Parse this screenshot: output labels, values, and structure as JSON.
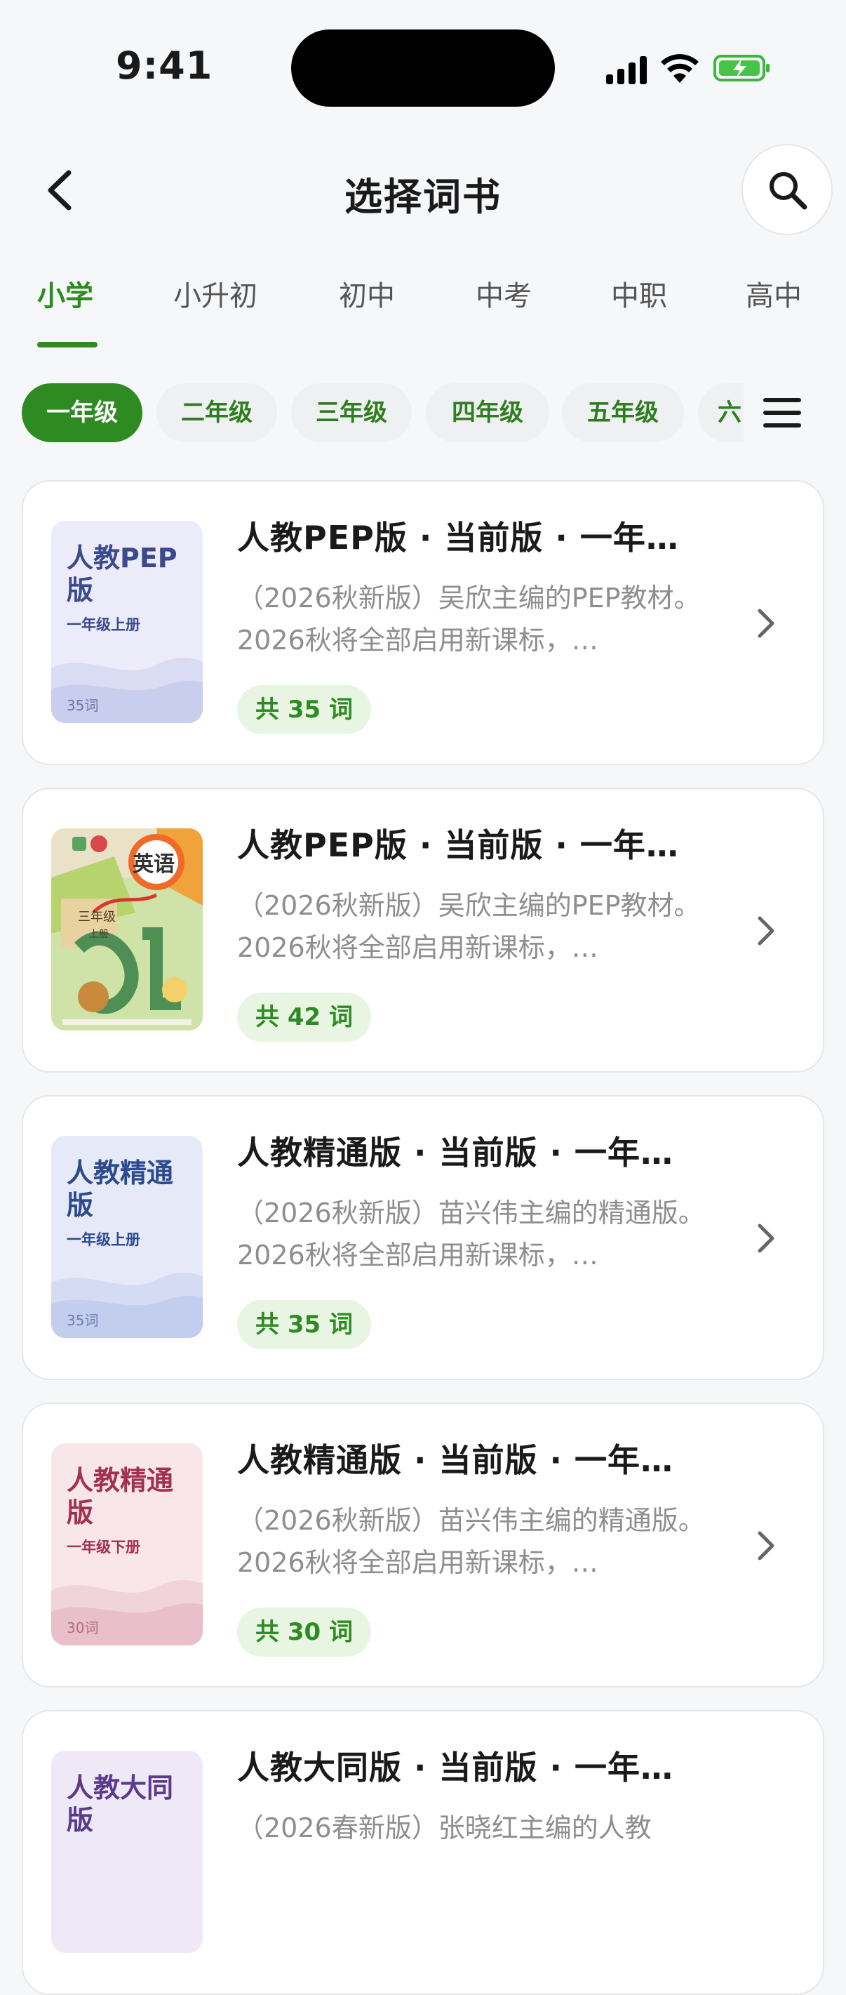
{
  "status_bar": {
    "time": "9:41"
  },
  "header": {
    "title": "选择词书"
  },
  "tabs": [
    {
      "label": "小学",
      "active": true
    },
    {
      "label": "小升初"
    },
    {
      "label": "初中"
    },
    {
      "label": "中考"
    },
    {
      "label": "中职"
    },
    {
      "label": "高中"
    }
  ],
  "grades": [
    {
      "label": "一年级",
      "active": true
    },
    {
      "label": "二年级"
    },
    {
      "label": "三年级"
    },
    {
      "label": "四年级"
    },
    {
      "label": "五年级"
    },
    {
      "label": "六"
    }
  ],
  "books": [
    {
      "title": "人教PEP版 · 当前版 · 一年…",
      "desc": "（2026秋新版）吴欣主编的PEP教材。2026秋将全部启用新课标，…",
      "count": "共 35 词",
      "cover": {
        "kind": "generated",
        "title": "人教PEP版",
        "sub": "一年级上册",
        "words": "35词",
        "bg": "#ECEBFA",
        "wave1": "#DADCF4",
        "wave2": "#C9CEEE",
        "fg": "#3A4A8A"
      }
    },
    {
      "title": "人教PEP版 · 当前版 · 一年…",
      "desc": "（2026秋新版）吴欣主编的PEP教材。2026秋将全部启用新课标，…",
      "count": "共 42 词",
      "cover": {
        "kind": "image",
        "badge": "英语",
        "grade_text": "三年级",
        "term_text": "上册"
      }
    },
    {
      "title": "人教精通版 · 当前版 · 一年…",
      "desc": "（2026秋新版）苗兴伟主编的精通版。2026秋将全部启用新课标，…",
      "count": "共 35 词",
      "cover": {
        "kind": "generated",
        "title": "人教精通版",
        "sub": "一年级上册",
        "words": "35词",
        "bg": "#E6EAF8",
        "wave1": "#D4DBF3",
        "wave2": "#C3CDEE",
        "fg": "#2C4A8E"
      }
    },
    {
      "title": "人教精通版 · 当前版 · 一年…",
      "desc": "（2026秋新版）苗兴伟主编的精通版。2026秋将全部启用新课标，…",
      "count": "共 30 词",
      "cover": {
        "kind": "generated",
        "title": "人教精通版",
        "sub": "一年级下册",
        "words": "30词",
        "bg": "#F8E6EA",
        "wave1": "#F1D3DB",
        "wave2": "#E8BFCB",
        "fg": "#A2314F"
      }
    },
    {
      "title": "人教大同版 · 当前版 · 一年…",
      "desc": "（2026春新版）张晓红主编的人教",
      "count": "",
      "cover": {
        "kind": "generated",
        "title": "人教大同版",
        "sub": "",
        "words": "",
        "bg": "#EEE8F7",
        "wave1": "#E0D7F1",
        "wave2": "#D3C8EC",
        "fg": "#5A3A8A"
      }
    }
  ],
  "icons": {
    "back": "chevron-left-icon",
    "search": "search-icon",
    "menu": "menu-icon",
    "row": "chevron-right-icon"
  },
  "colors": {
    "accent": "#2E8B22",
    "badge_bg": "#E8F5E3",
    "page_bg": "#F6F7F8"
  }
}
